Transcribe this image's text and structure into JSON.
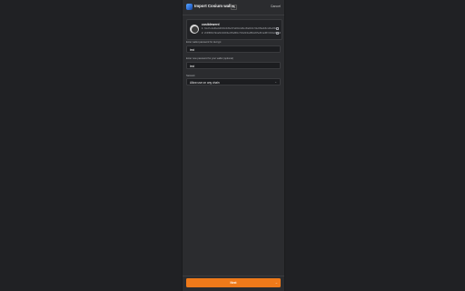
{
  "header": {
    "title": "Import Cosium wallet",
    "badge": "v1",
    "close_label": "Cancel"
  },
  "wallet": {
    "name": "cosiblewerd",
    "addresses": [
      {
        "label": "1:",
        "value": "3Gcl7e4sd8e2a9f1b6c0d5e3f7a2b9c4d8e1f6a0b3c7d2e5f9a4b8c1d6e0f3a7"
      },
      {
        "label": "2:",
        "value": "2K9f8B3d7E1a6C4b0D9e2F5a8B1c7D3e6F0a4B9c2D5e8F1a3B7c0D4e9F2a6"
      }
    ]
  },
  "fields": {
    "password_label": "Enter wallet password for decrypt",
    "password_value": "test",
    "confirm_label": "Enter new password for your wallet (optional)",
    "confirm_value": "test",
    "network_label": "Network",
    "network_value": "Allow use on any chain"
  },
  "footer": {
    "next_label": "Next",
    "next_arrow": "→"
  },
  "colors": {
    "accent": "#ef7a1a",
    "background": "#202124",
    "panel": "#2b2c2f"
  }
}
